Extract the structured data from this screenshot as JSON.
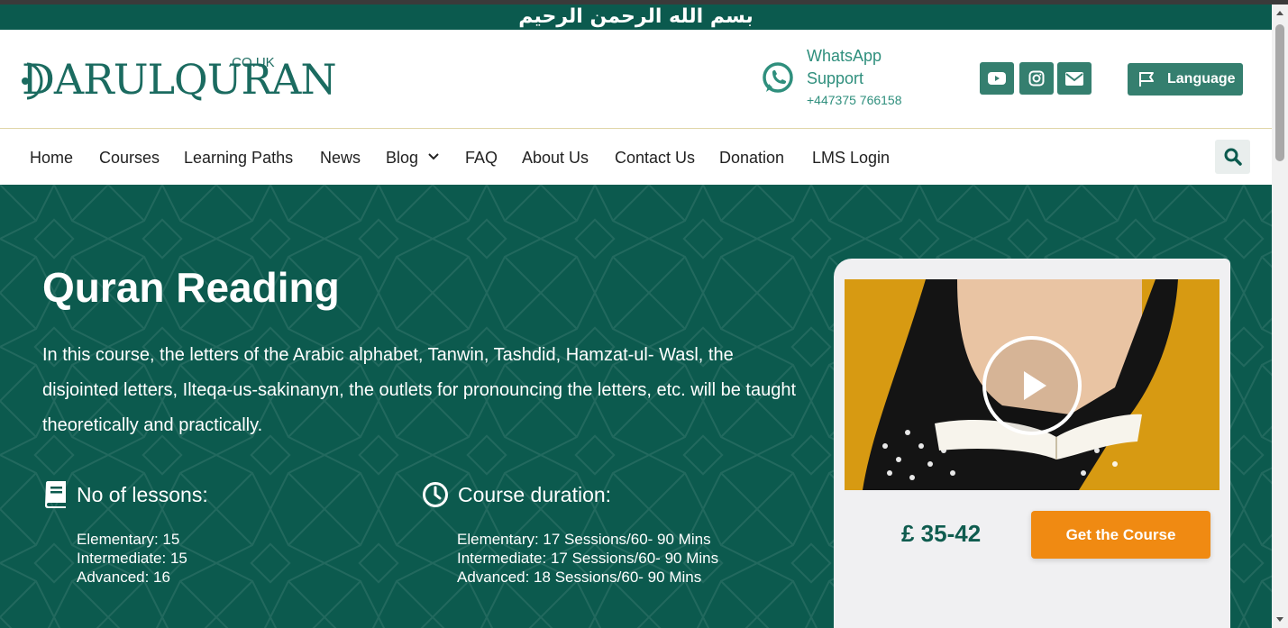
{
  "banner": {
    "calligraphy": "بسم الله الرحمن الرحيم"
  },
  "header": {
    "logo_text": "DARULQURAN",
    "logo_tld": ".CO.UK",
    "whatsapp": {
      "title": "WhatsApp Support",
      "phone": "+447375 766158"
    },
    "social": [
      {
        "icon": "youtube-icon"
      },
      {
        "icon": "instagram-icon"
      },
      {
        "icon": "envelope-icon"
      }
    ],
    "language_label": "Language"
  },
  "nav": {
    "items": [
      "Home",
      "Courses",
      "Learning Paths",
      "News",
      "Blog",
      "FAQ",
      "About Us",
      "Contact Us",
      "Donation",
      "LMS Login"
    ],
    "blog_has_dropdown": true
  },
  "hero": {
    "title": "Quran Reading",
    "description": "In this course, the letters of the Arabic alphabet, Tanwin, Tashdid, Hamzat-ul- Wasl, the disjointed letters, Ilteqa-us-sakinanyn, the outlets for pronouncing the letters, etc. will be taught theoretically and practically.",
    "lessons": {
      "heading": "No of lessons:",
      "items": [
        "Elementary: 15",
        "Intermediate: 15",
        "Advanced: 16"
      ]
    },
    "duration": {
      "heading": "Course duration:",
      "items": [
        "Elementary: 17 Sessions/60- 90 Mins",
        "Intermediate: 17 Sessions/60- 90 Mins",
        "Advanced: 18 Sessions/60- 90 Mins"
      ]
    }
  },
  "card": {
    "price": "£ 35-42",
    "cta": "Get the Course"
  },
  "colors": {
    "brand_green": "#0c5a4e",
    "accent_green": "#357f6f",
    "cta_orange": "#f08a12",
    "video_bg": "#d79a12"
  }
}
